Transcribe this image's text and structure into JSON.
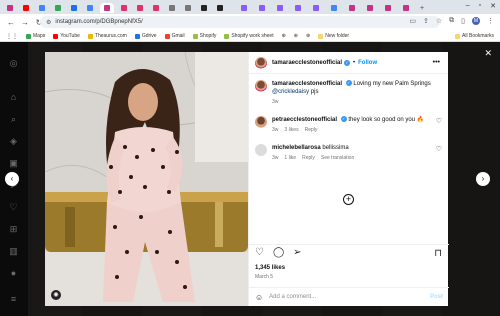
{
  "browser": {
    "url": "instagram.com/p/DGBpnepNfX5/",
    "bookmarks": [
      {
        "label": "Maps",
        "color": "#34a853"
      },
      {
        "label": "YouTube",
        "color": "#ff0000"
      },
      {
        "label": "Theaurus.com",
        "color": "#f4b400"
      },
      {
        "label": "Gdrive",
        "color": "#1a73e8"
      },
      {
        "label": "Gmail",
        "color": "#ea4335"
      },
      {
        "label": "Shopify",
        "color": "#95bf47"
      },
      {
        "label": "Shopify work sheet",
        "color": "#95bf47"
      },
      {
        "label": "New folder",
        "color": "#f9d36b"
      }
    ],
    "all_bookmarks": "All Bookmarks",
    "profile_initial": "M"
  },
  "post": {
    "author": "tamaraecclestoneofficial",
    "follow_label": "Follow",
    "caption_text": "Loving my new Palm Springs",
    "caption_mention": "@crickledaisy",
    "caption_suffix": " pjs",
    "caption_age": "3w",
    "comments": [
      {
        "user": "petraecclestoneofficial",
        "text": "they look so good on you",
        "emoji": "🔥",
        "age": "3w",
        "likes": "3 likes",
        "reply": "Reply"
      },
      {
        "user": "michelebellarosa",
        "text": "bellissima",
        "age": "3w",
        "likes": "1 like",
        "reply": "Reply",
        "see_translation": "See translation"
      }
    ],
    "like_count": "1,345 likes",
    "date": "March 5",
    "add_comment_placeholder": "Add a comment...",
    "post_label": "Post"
  },
  "colors": {
    "link_blue": "#0095f6",
    "verified_blue": "#3897f0"
  }
}
